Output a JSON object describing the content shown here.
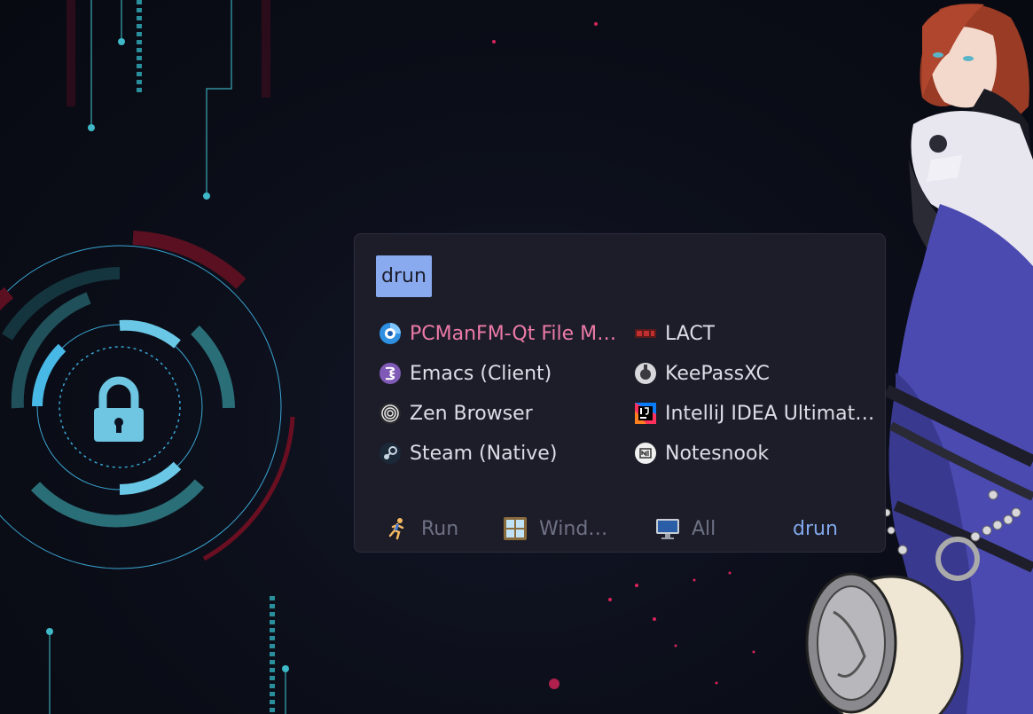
{
  "launcher": {
    "prompt": "drun",
    "apps": [
      {
        "label": "PCManFM-Qt File M…",
        "icon": "pcmanfm-qt-icon",
        "selected": true
      },
      {
        "label": "LACT",
        "icon": "lact-gpu-icon"
      },
      {
        "label": "Emacs (Client)",
        "icon": "emacs-icon"
      },
      {
        "label": "KeePassXC",
        "icon": "keepassxc-icon"
      },
      {
        "label": "Zen Browser",
        "icon": "zen-browser-icon"
      },
      {
        "label": "IntelliJ IDEA Ultimat…",
        "icon": "intellij-icon"
      },
      {
        "label": "Steam (Native)",
        "icon": "steam-icon"
      },
      {
        "label": "Notesnook",
        "icon": "notesnook-icon"
      }
    ],
    "modes": [
      {
        "label": "Run",
        "icon": "running-person-icon"
      },
      {
        "label": "Wind…",
        "icon": "windows-icon"
      },
      {
        "label": "All",
        "icon": "monitor-icon"
      },
      {
        "label": "drun",
        "active": true
      }
    ]
  },
  "colors": {
    "selected_text": "#ec7aa6",
    "prompt_bg": "#8aaaf0",
    "active_mode": "#82a8ec",
    "panel_bg": "#1e1e2a",
    "wallpaper_accent_cyan": "#3fb8d8",
    "wallpaper_accent_red": "#8a1428"
  }
}
